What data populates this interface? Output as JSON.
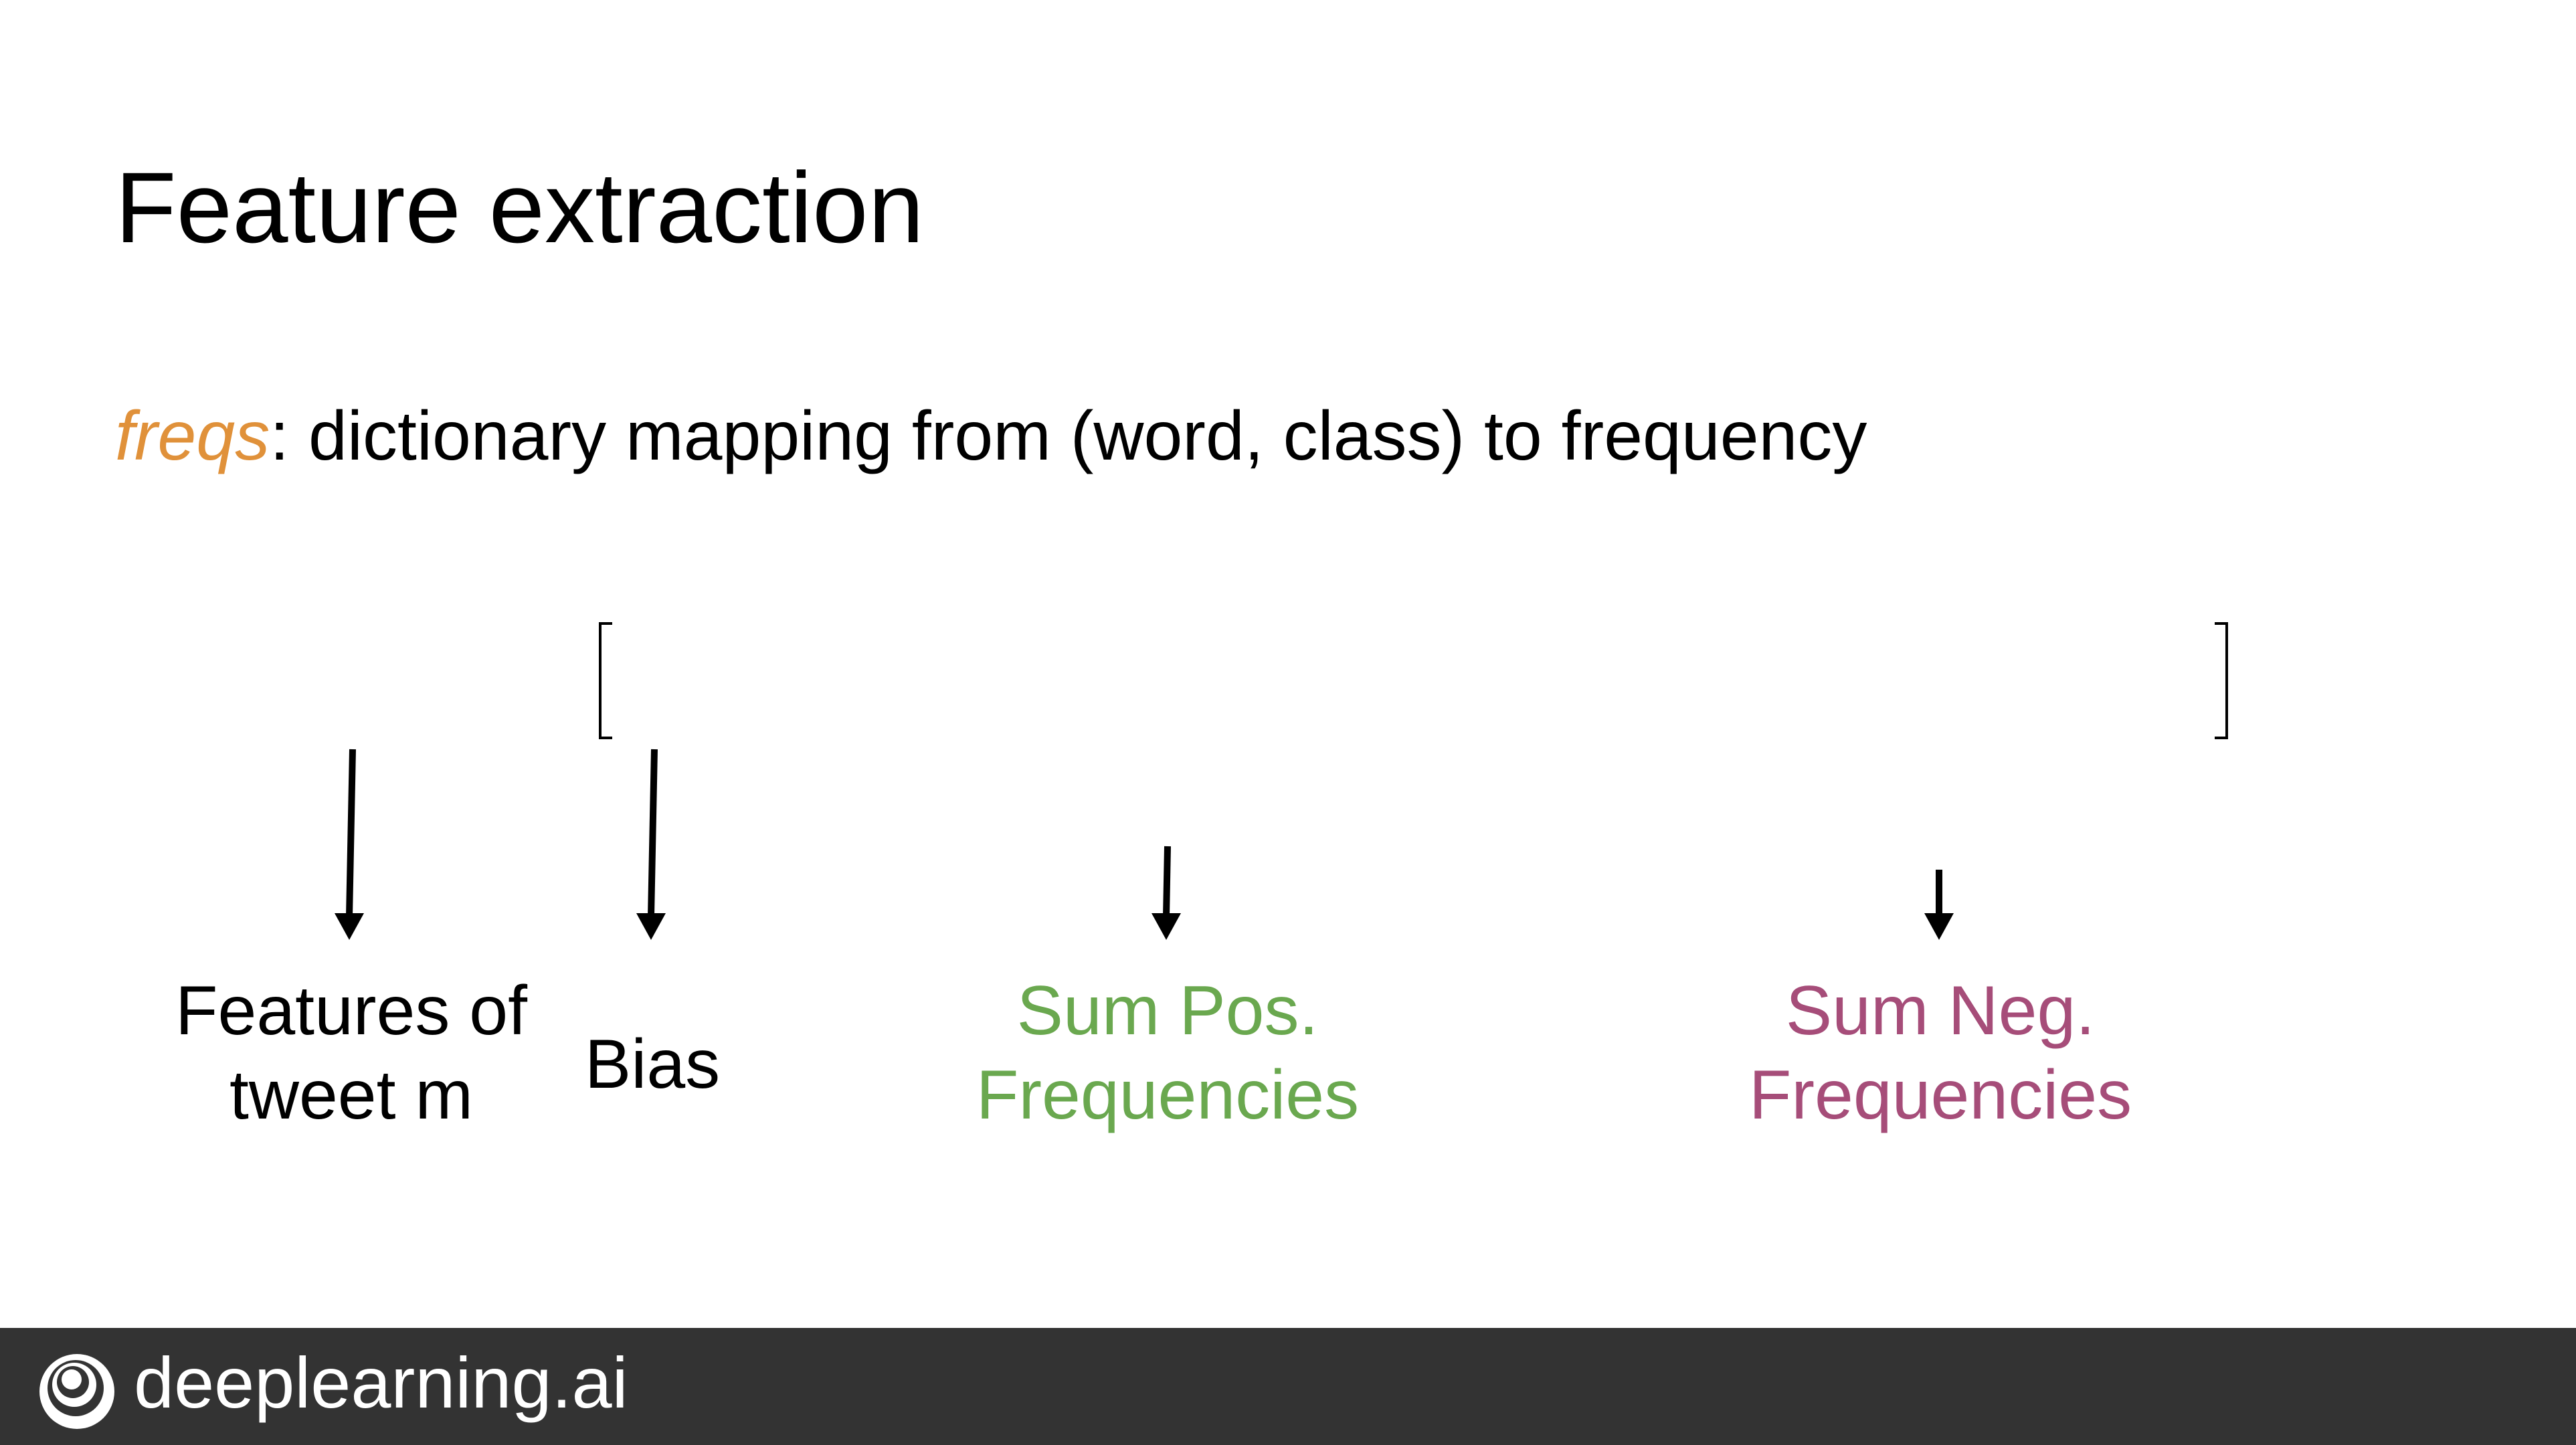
{
  "slide": {
    "title": "Feature extraction",
    "definition": {
      "term": "freqs",
      "text": ": dictionary mapping from (word, class) to frequency",
      "term_color": "#E0913A"
    }
  },
  "vector_labels": [
    {
      "lines": [
        "Features of",
        "tweet m"
      ],
      "color": "#000000"
    },
    {
      "lines": [
        "Bias"
      ],
      "color": "#000000"
    },
    {
      "lines": [
        "Sum Pos.",
        "Frequencies"
      ],
      "color": "#6AA84F"
    },
    {
      "lines": [
        "Sum Neg.",
        "Frequencies"
      ],
      "color": "#A64D79"
    }
  ],
  "footer": {
    "brand": "deeplearning.ai",
    "background": "#333333",
    "text_color": "#FFFFFF",
    "logo_icon": "deeplearning-logo-icon"
  }
}
